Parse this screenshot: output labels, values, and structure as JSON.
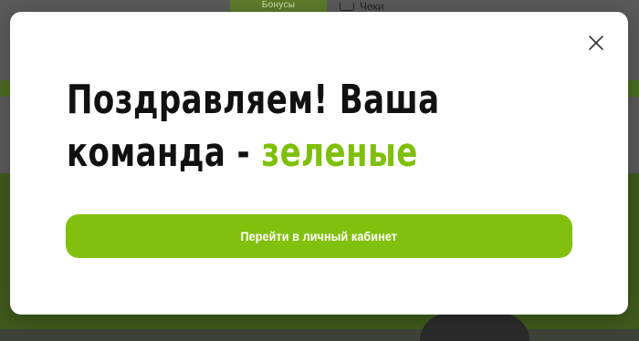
{
  "background": {
    "nav_tab_label": "Бонусы",
    "nav_receipts_label": "Чеки"
  },
  "modal": {
    "title_line1": "Поздравляем! Ваша",
    "title_line2_prefix": "команда - ",
    "title_team": "зеленые",
    "cta_label": "Перейти в личный кабинет",
    "close_icon": "close-icon"
  },
  "colors": {
    "accent": "#82c00e",
    "team_text": "#7fbf0a",
    "title_text": "#111111",
    "modal_bg": "#ffffff"
  }
}
